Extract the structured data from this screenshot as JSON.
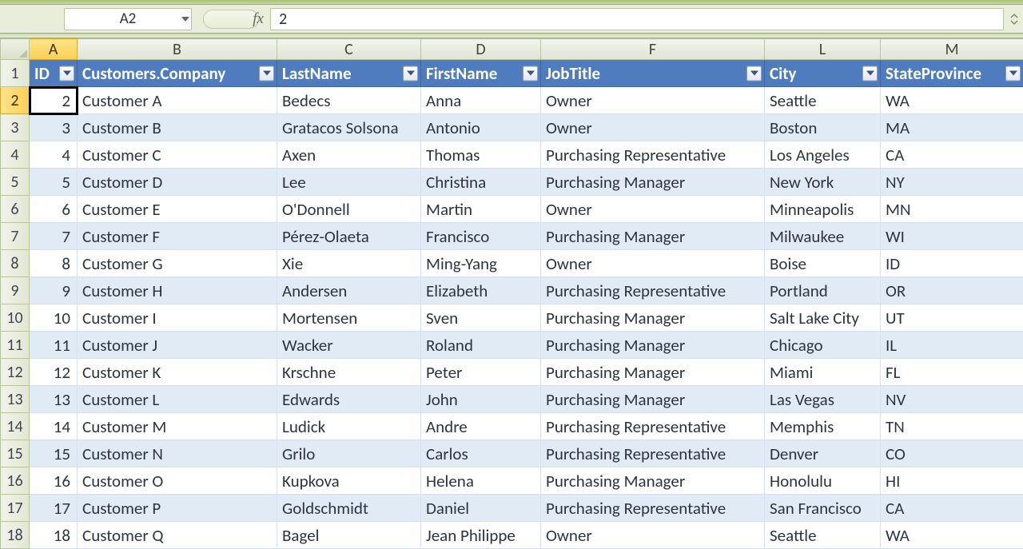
{
  "nameBox": "A2",
  "fxLabel": "fx",
  "formulaValue": "2",
  "columnLetters": [
    "A",
    "B",
    "C",
    "D",
    "F",
    "L",
    "M"
  ],
  "selectedColumn": "A",
  "selectedRowNumber": 2,
  "headers": {
    "id": "ID",
    "company": "Customers.Company",
    "lastName": "LastName",
    "firstName": "FirstName",
    "jobTitle": "JobTitle",
    "city": "City",
    "stateProvince": "StateProvince"
  },
  "rows": [
    {
      "n": 2,
      "id": "2",
      "company": "Customer A",
      "lastName": "Bedecs",
      "firstName": "Anna",
      "jobTitle": "Owner",
      "city": "Seattle",
      "state": "WA"
    },
    {
      "n": 3,
      "id": "3",
      "company": "Customer B",
      "lastName": "Gratacos Solsona",
      "firstName": "Antonio",
      "jobTitle": "Owner",
      "city": "Boston",
      "state": "MA"
    },
    {
      "n": 4,
      "id": "4",
      "company": "Customer C",
      "lastName": "Axen",
      "firstName": "Thomas",
      "jobTitle": "Purchasing Representative",
      "city": "Los Angeles",
      "state": "CA"
    },
    {
      "n": 5,
      "id": "5",
      "company": "Customer D",
      "lastName": "Lee",
      "firstName": "Christina",
      "jobTitle": "Purchasing Manager",
      "city": "New York",
      "state": "NY"
    },
    {
      "n": 6,
      "id": "6",
      "company": "Customer E",
      "lastName": "O'Donnell",
      "firstName": "Martin",
      "jobTitle": "Owner",
      "city": "Minneapolis",
      "state": "MN"
    },
    {
      "n": 7,
      "id": "7",
      "company": "Customer F",
      "lastName": "Pérez-Olaeta",
      "firstName": "Francisco",
      "jobTitle": "Purchasing Manager",
      "city": "Milwaukee",
      "state": "WI"
    },
    {
      "n": 8,
      "id": "8",
      "company": "Customer G",
      "lastName": "Xie",
      "firstName": "Ming-Yang",
      "jobTitle": "Owner",
      "city": "Boise",
      "state": "ID"
    },
    {
      "n": 9,
      "id": "9",
      "company": "Customer H",
      "lastName": "Andersen",
      "firstName": "Elizabeth",
      "jobTitle": "Purchasing Representative",
      "city": "Portland",
      "state": "OR"
    },
    {
      "n": 10,
      "id": "10",
      "company": "Customer I",
      "lastName": "Mortensen",
      "firstName": "Sven",
      "jobTitle": "Purchasing Manager",
      "city": "Salt Lake City",
      "state": "UT"
    },
    {
      "n": 11,
      "id": "11",
      "company": "Customer J",
      "lastName": "Wacker",
      "firstName": "Roland",
      "jobTitle": "Purchasing Manager",
      "city": "Chicago",
      "state": "IL"
    },
    {
      "n": 12,
      "id": "12",
      "company": "Customer K",
      "lastName": "Krschne",
      "firstName": "Peter",
      "jobTitle": "Purchasing Manager",
      "city": "Miami",
      "state": "FL"
    },
    {
      "n": 13,
      "id": "13",
      "company": "Customer L",
      "lastName": "Edwards",
      "firstName": "John",
      "jobTitle": "Purchasing Manager",
      "city": "Las Vegas",
      "state": "NV"
    },
    {
      "n": 14,
      "id": "14",
      "company": "Customer M",
      "lastName": "Ludick",
      "firstName": "Andre",
      "jobTitle": "Purchasing Representative",
      "city": "Memphis",
      "state": "TN"
    },
    {
      "n": 15,
      "id": "15",
      "company": "Customer N",
      "lastName": "Grilo",
      "firstName": "Carlos",
      "jobTitle": "Purchasing Representative",
      "city": "Denver",
      "state": "CO"
    },
    {
      "n": 16,
      "id": "16",
      "company": "Customer O",
      "lastName": "Kupkova",
      "firstName": "Helena",
      "jobTitle": "Purchasing Manager",
      "city": "Honolulu",
      "state": "HI"
    },
    {
      "n": 17,
      "id": "17",
      "company": "Customer P",
      "lastName": "Goldschmidt",
      "firstName": "Daniel",
      "jobTitle": "Purchasing Representative",
      "city": "San Francisco",
      "state": "CA"
    },
    {
      "n": 18,
      "id": "18",
      "company": "Customer Q",
      "lastName": "Bagel",
      "firstName": "Jean Philippe",
      "jobTitle": "Owner",
      "city": "Seattle",
      "state": "WA"
    }
  ]
}
